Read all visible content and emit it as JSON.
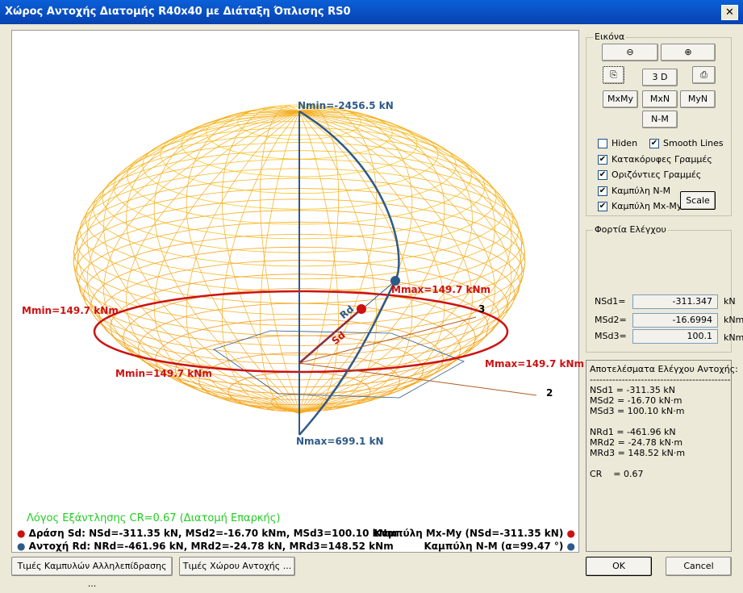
{
  "window": {
    "title": "Χώρος Αντοχής Διατομής R40x40 με Διάταξη Όπλισης RS0",
    "close": "✕"
  },
  "plot": {
    "labels": {
      "nmin": "Nmin=-2456.5 kN",
      "nmax": "Nmax=699.1 kN",
      "mmax_top": "Mmax=149.7 kNm",
      "mmin_left": "Mmin=149.7 kNm",
      "mmin_bottom": "Mmin=149.7 kNm",
      "mmax_right": "Mmax=149.7 kNm",
      "rd": "Rd",
      "sd": "Sd",
      "axis2": "2",
      "axis3": "3"
    },
    "colors": {
      "mesh_top": "#f5d020",
      "mesh_bottom": "#f58a1e",
      "mxmy": "#cc1111",
      "nm": "#2e5a88",
      "cr": "#22cc22"
    },
    "cr_text": "Λόγος Εξάντλησης CR=0.67  (Διατομή Επαρκής)",
    "sd_text": "Δράση  Sd: NSd=-311.35 kN,  MSd2=-16.70 kNm,  MSd3=100.10 kNm",
    "rd_text": "Αντοχή Rd: NRd=-461.96 kN,  MRd2=-24.78 kN,  MRd3=148.52 kNm",
    "mxmy_legend": "Καμπύλη Mx-My (NSd=-311.35 kN)",
    "nm_legend": "Καμπύλη N-M (α=99.47 °)"
  },
  "image_group": {
    "title": "Εικόνα",
    "zoom_out": "zoom-out-icon",
    "zoom_in": "zoom-in-icon",
    "copy": "copy-icon",
    "print": "print-icon",
    "btn_3d": "3 D",
    "btn_mxmy": "MxMy",
    "btn_mxn": "MxN",
    "btn_myn": "MyN",
    "btn_nm": "N-M",
    "scale": "Scale",
    "checks": [
      {
        "label": "Hiden",
        "checked": false
      },
      {
        "label": "Smooth Lines",
        "checked": true
      },
      {
        "label": "Κατακόρυφες Γραμμές",
        "checked": true
      },
      {
        "label": "Οριζόντιες Γραμμές",
        "checked": true
      },
      {
        "label": "Καμπύλη N-M",
        "checked": true
      },
      {
        "label": "Καμπύλη Mx-My",
        "checked": true
      }
    ]
  },
  "loads": {
    "title": "Φορτία Ελέγχου",
    "rows": [
      {
        "label": "NSd1=",
        "value": "-311.347",
        "unit": "kN"
      },
      {
        "label": "MSd2=",
        "value": "-16.6994",
        "unit": "kNm"
      },
      {
        "label": "MSd3=",
        "value": "100.1",
        "unit": "kNm"
      }
    ]
  },
  "results": {
    "text": "Αποτελέσματα Ελέγχου Αντοχής:\n--------------------------------------------\nNSd1 = -311.35 kN\nMSd2 = -16.70 kN·m\nMSd3 = 100.10 kN·m\n\nNRd1 = -461.96 kN\nMRd2 = -24.78 kN·m\nMRd3 = 148.52 kN·m\n\nCR    = 0.67"
  },
  "footer": {
    "curves_btn": "Τιμές Καμπυλών Αλληλεπίδρασης ...",
    "space_btn": "Τιμές Χώρου Αντοχής ...",
    "ok": "OK",
    "cancel": "Cancel"
  }
}
